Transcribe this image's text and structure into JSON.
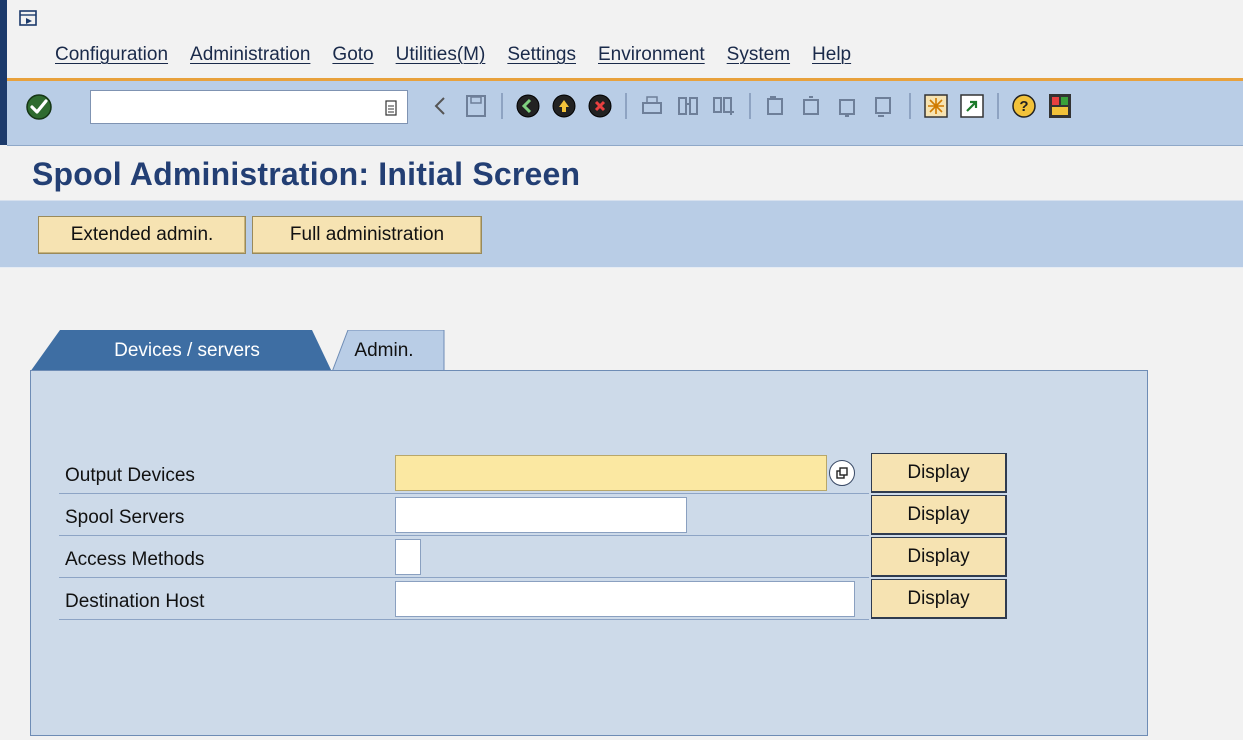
{
  "menu": {
    "items": [
      "Configuration",
      "Administration",
      "Goto",
      "Utilities(M)",
      "Settings",
      "Environment",
      "System",
      "Help"
    ]
  },
  "toolbar": {
    "command_value": "",
    "icons": [
      "enter-icon",
      "back-arrow-icon",
      "save-icon",
      "back-icon",
      "exit-icon",
      "cancel-icon",
      "print-icon",
      "find-icon",
      "find-next-icon",
      "first-page-icon",
      "previous-page-icon",
      "next-page-icon",
      "last-page-icon",
      "create-session-icon",
      "shortcut-icon",
      "help-icon",
      "customize-layout-icon"
    ]
  },
  "page": {
    "title": "Spool Administration: Initial Screen"
  },
  "app_toolbar": {
    "extended_label": "Extended admin.",
    "full_label": "Full administration"
  },
  "tabs": {
    "devices_label": "Devices / servers",
    "admin_label": "Admin."
  },
  "form": {
    "rows": [
      {
        "label": "Output Devices",
        "value": "",
        "button": "Display"
      },
      {
        "label": "Spool Servers",
        "value": "",
        "button": "Display"
      },
      {
        "label": "Access Methods",
        "value": "",
        "button": "Display"
      },
      {
        "label": "Destination Host",
        "value": "",
        "button": "Display"
      }
    ]
  }
}
